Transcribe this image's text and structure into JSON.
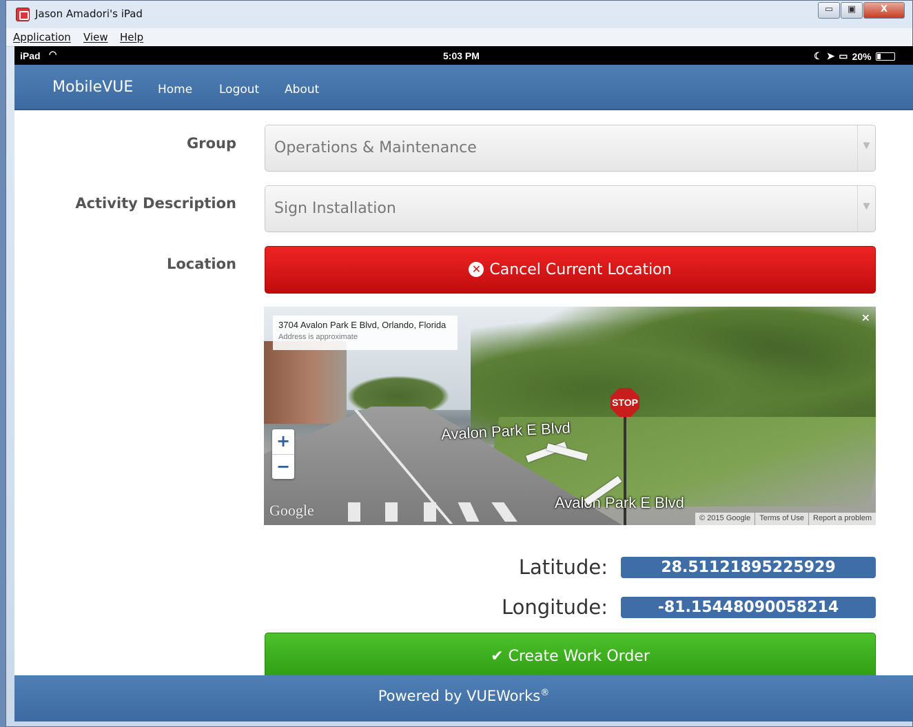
{
  "window": {
    "title": "Jason Amadori's iPad",
    "controls": {
      "minimize": "▭",
      "maximize": "▣",
      "close": "X"
    }
  },
  "menubar": {
    "items": [
      "Application",
      "View",
      "Help"
    ]
  },
  "status_bar": {
    "device": "iPad",
    "time": "5:03 PM",
    "battery": "20%"
  },
  "navbar": {
    "brand": "MobileVUE",
    "links": [
      "Home",
      "Logout",
      "About"
    ]
  },
  "form": {
    "group_label": "Group",
    "group_value": "Operations & Maintenance",
    "activity_label": "Activity Description",
    "activity_value": "Sign Installation",
    "location_label": "Location",
    "cancel_location_label": "Cancel Current Location"
  },
  "street_view": {
    "address": "3704 Avalon Park E Blvd, Orlando, Florida",
    "address_note": "Address is approximate",
    "street_label_1": "Avalon Park E Blvd",
    "street_label_2": "Avalon Park E Blvd",
    "sign_text": "STOP",
    "logo": "Google",
    "zoom_in": "+",
    "zoom_out": "−",
    "close": "×",
    "footer": [
      "© 2015 Google",
      "Terms of Use",
      "Report a problem"
    ]
  },
  "coordinates": {
    "latitude_label": "Latitude:",
    "latitude_value": "28.51121895225929",
    "longitude_label": "Longitude:",
    "longitude_value": "-81.15448090058214"
  },
  "create_work_order_label": "Create Work Order",
  "footer": {
    "text": "Powered by VUEWorks",
    "mark": "®"
  }
}
